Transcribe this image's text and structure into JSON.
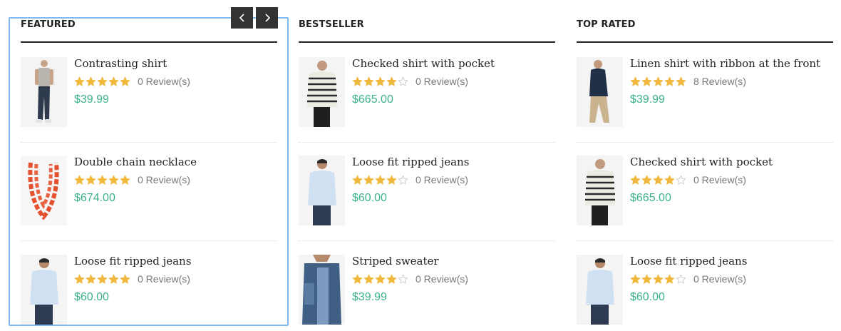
{
  "colors": {
    "accent_price": "#3cb28a",
    "star_filled": "#f0b93d",
    "star_empty": "#d0d0d0",
    "nav_button_bg": "#333333",
    "focus_outline": "#7fb8ef"
  },
  "icons": {
    "prev": "chevron-left-icon",
    "next": "chevron-right-icon",
    "star": "star-icon"
  },
  "columns": [
    {
      "title": "FEATURED",
      "products": [
        {
          "name": "Contrasting shirt",
          "rating": 5,
          "reviews": "0 Review(s)",
          "price": "$39.99",
          "image": "model-grey-tee-jeans"
        },
        {
          "name": "Double chain necklace",
          "rating": 5,
          "reviews": "0 Review(s)",
          "price": "$674.00",
          "image": "orange-chain-necklace"
        },
        {
          "name": "Loose fit ripped jeans",
          "rating": 5,
          "reviews": "0 Review(s)",
          "price": "$60.00",
          "image": "model-light-blue-shirt"
        }
      ]
    },
    {
      "title": "BESTSELLER",
      "products": [
        {
          "name": "Checked shirt with pocket",
          "rating": 4,
          "reviews": "0 Review(s)",
          "price": "$665.00",
          "image": "model-striped-sweater"
        },
        {
          "name": "Loose fit ripped jeans",
          "rating": 4,
          "reviews": "0 Review(s)",
          "price": "$60.00",
          "image": "model-light-blue-shirt"
        },
        {
          "name": "Striped sweater",
          "rating": 4,
          "reviews": "0 Review(s)",
          "price": "$39.99",
          "image": "denim-patchwork-shirt"
        }
      ]
    },
    {
      "title": "TOP RATED",
      "products": [
        {
          "name": "Linen shirt with ribbon at the front",
          "rating": 5,
          "reviews": "8 Review(s)",
          "price": "$39.99",
          "image": "model-navy-shirt-chinos"
        },
        {
          "name": "Checked shirt with pocket",
          "rating": 4,
          "reviews": "0 Review(s)",
          "price": "$665.00",
          "image": "model-striped-sweater"
        },
        {
          "name": "Loose fit ripped jeans",
          "rating": 4,
          "reviews": "0 Review(s)",
          "price": "$60.00",
          "image": "model-light-blue-shirt"
        }
      ]
    }
  ]
}
